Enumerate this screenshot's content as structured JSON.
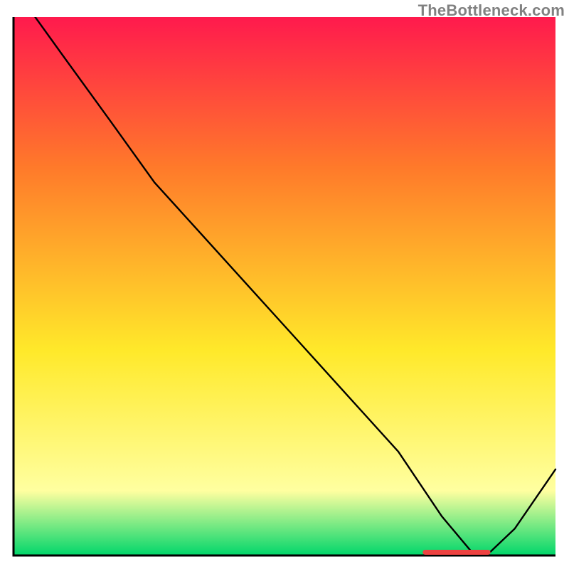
{
  "watermark": "TheBottleneck.com",
  "colors": {
    "gradient_top": "#ff1a4d",
    "gradient_mid1": "#ff7a2a",
    "gradient_mid2": "#ffe92a",
    "gradient_mid3": "#ffffa0",
    "gradient_bottom": "#00d66a",
    "axis": "#000000",
    "curve": "#000000",
    "marker": "#ed4241"
  },
  "chart_data": {
    "type": "line",
    "title": "",
    "xlabel": "",
    "ylabel": "",
    "xlim": [
      0,
      100
    ],
    "ylim": [
      0,
      100
    ],
    "grid": false,
    "legend": false,
    "series": [
      {
        "name": "curve",
        "x": [
          4,
          9,
          18,
          26,
          35,
          44,
          53,
          62,
          71,
          79,
          84.5,
          88,
          92.5,
          100
        ],
        "values": [
          100,
          93,
          80.5,
          69.3,
          59.3,
          49.3,
          39.3,
          29.3,
          19.3,
          7.3,
          0.7,
          0.7,
          5.0,
          16.0
        ]
      }
    ],
    "marker_segment": {
      "x0": 75.5,
      "x1": 88.0,
      "y": 0.6
    }
  }
}
